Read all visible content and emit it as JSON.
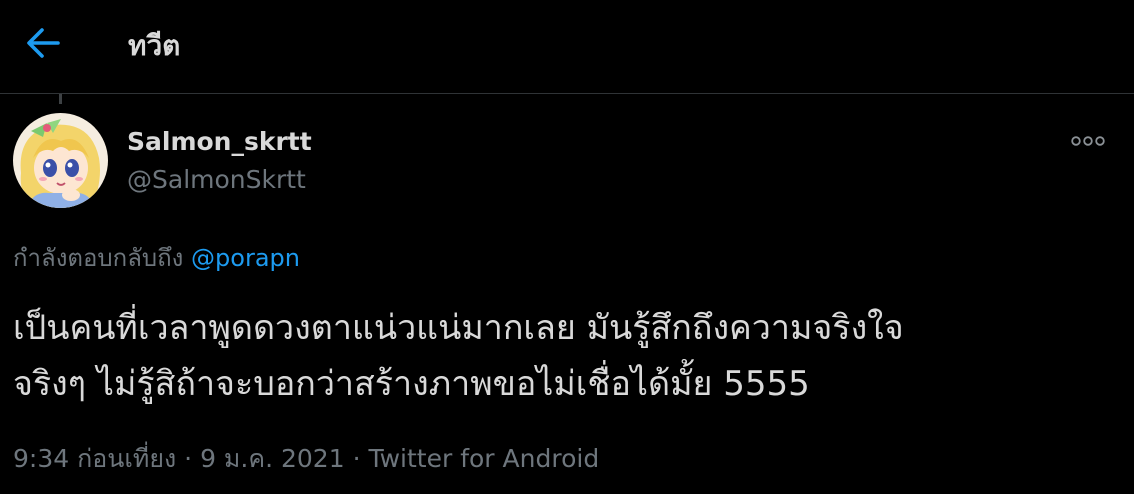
{
  "header": {
    "title": "ทวีต",
    "back_icon": "arrow-left-icon",
    "accent_color": "#1d9bf0"
  },
  "tweet": {
    "author": {
      "display_name": "Salmon_skrtt",
      "handle": "@SalmonSkrtt",
      "avatar": "anime-girl-avatar"
    },
    "more_icon": "more-horizontal-icon",
    "reply_prefix": "กำลังตอบกลับถึง",
    "reply_to": "@porapn",
    "text_line_1": "เป็นคนที่เวลาพูดดวงตาแน่วแน่มากเลย มันรู้สึกถึงความจริงใจ",
    "text_line_2": "จริงๆ ไม่รู้สิถ้าจะบอกว่าสร้างภาพขอไม่เชื่อได้มั้ย 5555",
    "time": "9:34 ก่อนเที่ยง",
    "separator": "·",
    "date": "9 ม.ค. 2021",
    "source": "Twitter for Android"
  }
}
